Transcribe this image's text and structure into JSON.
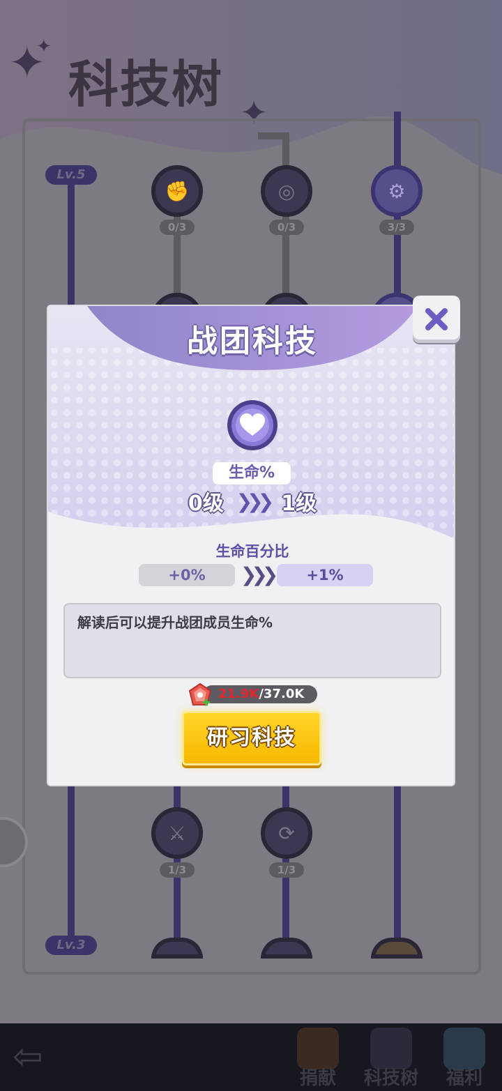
{
  "page": {
    "title": "科技树"
  },
  "tree": {
    "level_badges": [
      "Lv.5",
      "Lv.3"
    ],
    "top_nodes": [
      {
        "count": "0/3",
        "icon": "fist-up-icon"
      },
      {
        "count": "0/3",
        "icon": "swirl-icon"
      },
      {
        "count": "3/3",
        "icon": "gear-swap-icon"
      }
    ],
    "bottom_nodes": [
      {
        "count": "1/3",
        "icon": "sword-icon"
      },
      {
        "count": "1/3",
        "icon": "refresh-icon"
      }
    ]
  },
  "dialog": {
    "title": "战团科技",
    "skill_name": "生命%",
    "level_from": "0级",
    "level_to": "1级",
    "stat_name": "生命百分比",
    "stat_from": "+0%",
    "stat_to": "+1%",
    "description": "解读后可以提升战团成员生命%",
    "cost_have": "21.9K",
    "cost_need": "/37.0K",
    "button_label": "研习科技"
  },
  "nav": {
    "tabs": [
      {
        "label": "捐献"
      },
      {
        "label": "科技树"
      },
      {
        "label": "福利"
      }
    ]
  },
  "colors": {
    "accent_purple": "#6452b0",
    "button_yellow": "#f7b800",
    "cost_red": "#e5252c"
  }
}
